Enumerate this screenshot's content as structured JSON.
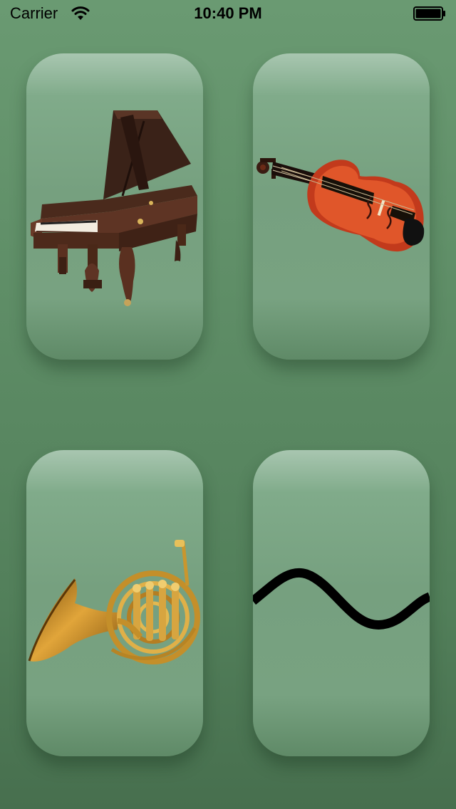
{
  "status_bar": {
    "carrier": "Carrier",
    "time": "10:40 PM",
    "wifi_icon": "wifi-icon",
    "battery_icon": "battery-icon"
  },
  "tiles": [
    {
      "name": "tile-piano",
      "icon": "grand-piano-icon"
    },
    {
      "name": "tile-violin",
      "icon": "violin-icon"
    },
    {
      "name": "tile-horn",
      "icon": "french-horn-icon"
    },
    {
      "name": "tile-wave",
      "icon": "sine-wave-icon"
    }
  ],
  "colors": {
    "background_top": "#6a9a72",
    "background_bottom": "#476f4e",
    "tile": "#78a281",
    "wave_stroke": "#000000"
  }
}
